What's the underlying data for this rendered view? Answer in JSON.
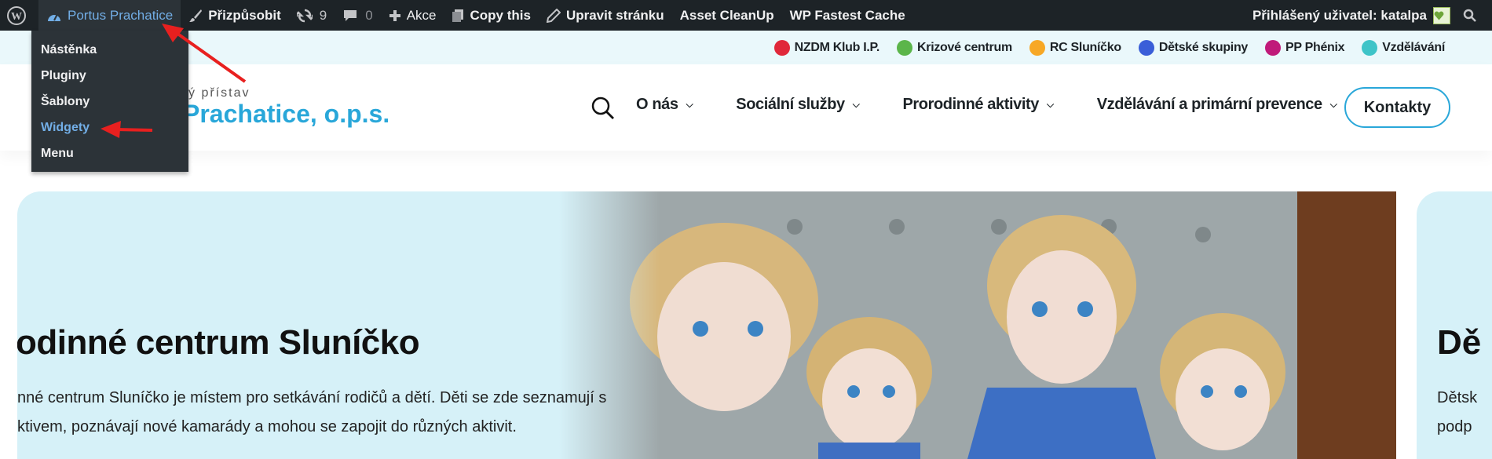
{
  "adminbar": {
    "site_name": "Portus Prachatice",
    "customize": "Přizpůsobit",
    "updates_count": "9",
    "comments_count": "0",
    "new": "Akce",
    "copy": "Copy this",
    "edit": "Upravit stránku",
    "asset": "Asset CleanUp",
    "cache": "WP Fastest Cache",
    "user": "Přihlášený uživatel: katalpa"
  },
  "dropdown": {
    "items": [
      "Nástěnka",
      "Pluginy",
      "Šablony",
      "Widgety",
      "Menu"
    ],
    "current": "Widgety"
  },
  "strip": {
    "links": [
      {
        "label": "NZDM Klub I.P.",
        "color": "#e0283a"
      },
      {
        "label": "Krizové centrum",
        "color": "#5bb54a"
      },
      {
        "label": "RC Sluníčko",
        "color": "#f7a826"
      },
      {
        "label": "Dětské skupiny",
        "color": "#3a5ed8"
      },
      {
        "label": "PP Phénix",
        "color": "#c01a7a"
      },
      {
        "label": "Vzdělávání",
        "color": "#3ec4c8"
      }
    ]
  },
  "header": {
    "logo_small": "ý přístav",
    "logo_big": "Prachatice, o.p.s.",
    "nav": [
      "O nás",
      "Sociální služby",
      "Prorodinné aktivity",
      "Vzdělávání a primární prevence"
    ],
    "contact": "Kontakty"
  },
  "hero": {
    "title": "odinné centrum Sluníčko",
    "line1": "nné centrum Sluníčko je místem pro setkávání rodičů a dětí. Děti se zde seznamují s",
    "line2": "ktivem, poznávají nové kamarády a mohou se zapojit do různých aktivit."
  },
  "hero2": {
    "title": "Dě",
    "line1": "Dětsk",
    "line2": "podp"
  },
  "colors": {
    "accent": "#29a7d9",
    "adminbar": "#1d2327",
    "annotation": "#e8201f"
  }
}
